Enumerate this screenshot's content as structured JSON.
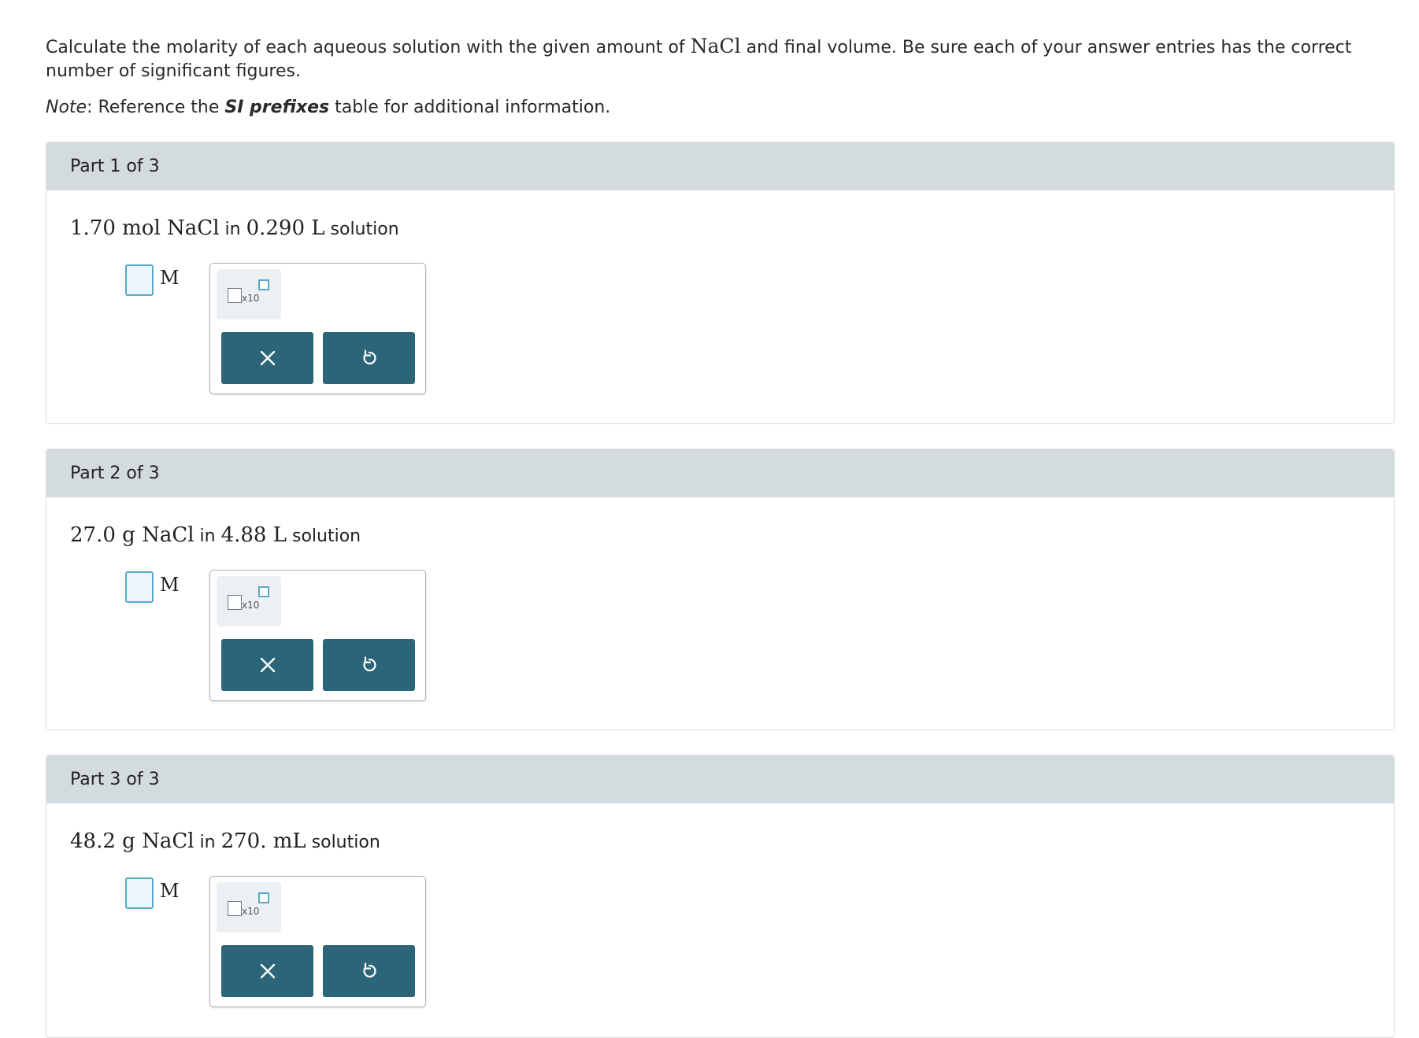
{
  "intro": {
    "text_before": "Calculate the molarity of each aqueous solution with the given amount of ",
    "compound": "NaCl",
    "text_after": " and final volume. Be sure each of your answer entries has the correct number of significant figures."
  },
  "note": {
    "label": "Note",
    "text_before": ": Reference the ",
    "link": "SI prefixes",
    "text_after": " table for additional information."
  },
  "parts": [
    {
      "header": "Part 1 of 3",
      "amount": "1.70 mol NaCl",
      "connector": " in ",
      "volume": "0.290 L",
      "suffix": " solution",
      "unit": "M",
      "x10_label": "x10"
    },
    {
      "header": "Part 2 of 3",
      "amount": "27.0 g NaCl",
      "connector": " in ",
      "volume": "4.88 L",
      "suffix": " solution",
      "unit": "M",
      "x10_label": "x10"
    },
    {
      "header": "Part 3 of 3",
      "amount": "48.2 g NaCl",
      "connector": " in ",
      "volume": "270. mL",
      "suffix": " solution",
      "unit": "M",
      "x10_label": "x10"
    }
  ],
  "icons": {
    "clear": "close-icon",
    "undo": "undo-icon"
  },
  "colors": {
    "header_bg": "#d3dbdf",
    "button_bg": "#2c6577",
    "input_border": "#5aa9c6",
    "input_bg": "#eaf6fb"
  }
}
